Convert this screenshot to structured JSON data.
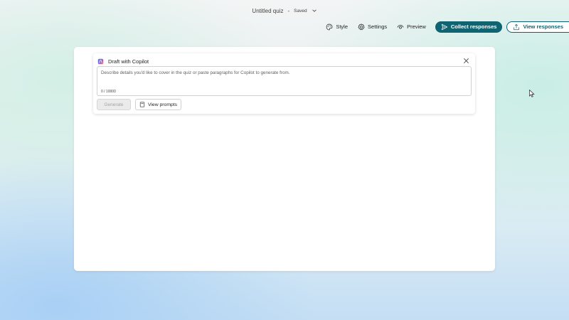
{
  "header": {
    "doc_title": "Untitled quiz",
    "separator": "-",
    "save_status": "Saved"
  },
  "toolbar": {
    "style_label": "Style",
    "settings_label": "Settings",
    "preview_label": "Preview",
    "collect_label": "Collect responses",
    "view_responses_label": "View responses"
  },
  "copilot": {
    "title": "Draft with Copilot",
    "placeholder": "Describe details you'd like to cover in the quiz or paste paragraphs for Copilot to generate from.",
    "value": "",
    "counter": "0 / 10000",
    "generate_label": "Generate",
    "view_prompts_label": "View prompts"
  },
  "colors": {
    "accent": "#106471",
    "disabled_bg": "#ebebeb",
    "disabled_text": "#a3a3a3"
  },
  "icons": {
    "style": "palette-icon",
    "settings": "gear-icon",
    "preview": "eye-icon",
    "collect": "send-icon",
    "view_responses": "share-icon",
    "copilot": "copilot-logo-icon",
    "close": "close-icon",
    "view_prompts": "notebook-icon",
    "dropdown": "chevron-down-icon"
  }
}
